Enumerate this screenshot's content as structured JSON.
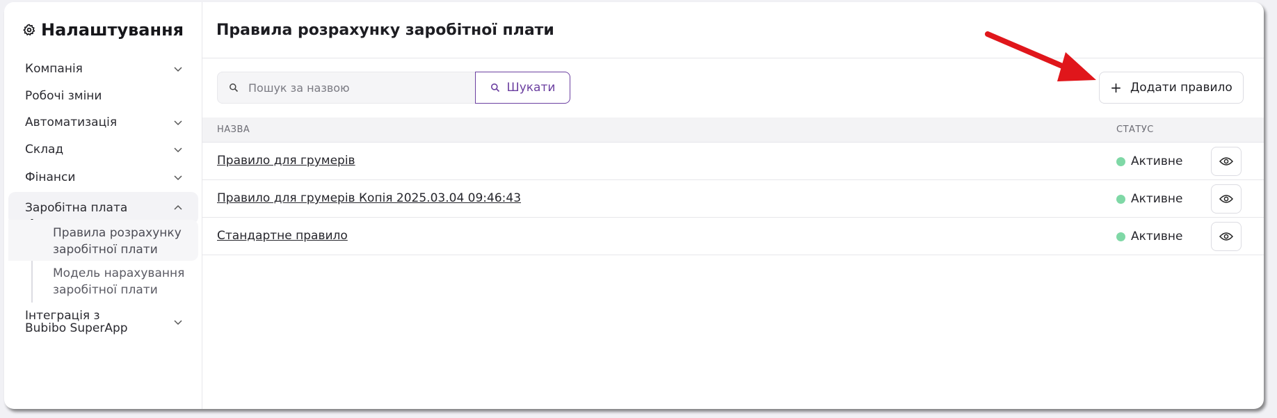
{
  "sidebar": {
    "title": "Налаштування",
    "items": [
      {
        "label": "Компанія"
      },
      {
        "label": "Робочі зміни"
      },
      {
        "label": "Автоматизація"
      },
      {
        "label": "Склад"
      },
      {
        "label": "Фінанси"
      },
      {
        "label": "Заробітна плата"
      },
      {
        "label": "Інтеграція з Bubibo SuperApp"
      }
    ],
    "sub_items": [
      {
        "label": "Правила розрахунку заробітної плати"
      },
      {
        "label": "Модель нарахування заробітної плати"
      }
    ]
  },
  "main": {
    "title": "Правила розрахунку заробітної плати",
    "search_placeholder": "Пошук за назвою",
    "search_button": "Шукати",
    "add_button": "Додати правило",
    "columns": {
      "name": "НАЗВА",
      "status": "СТАТУС"
    },
    "rows": [
      {
        "name": "Правило для грумерів",
        "status": "Активне"
      },
      {
        "name": "Правило для грумерів Копія 2025.03.04 09:46:43",
        "status": "Активне"
      },
      {
        "name": "Стандартне правило",
        "status": "Активне"
      }
    ]
  },
  "colors": {
    "accent": "#6b3fa0",
    "status_active": "#7fd8a6",
    "annotation_arrow": "#e0161b"
  }
}
